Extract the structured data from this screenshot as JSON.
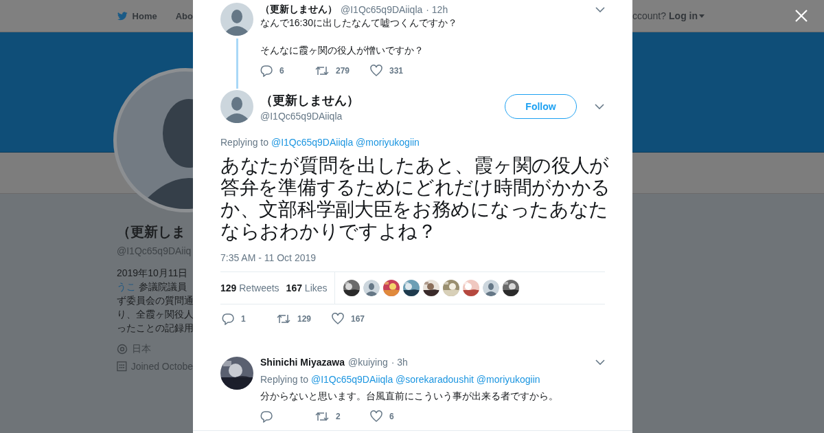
{
  "header": {
    "nav_items": [
      "Home",
      "Abo"
    ],
    "account_prompt": "ccount?",
    "login": "Log in"
  },
  "profile": {
    "name": "（更新しま",
    "handle": "@I1Qc65q9DAiiq",
    "bio_lines": [
      {
        "text": "2019年10月11日"
      },
      {
        "link": "うこ",
        "text": " 参議院議員"
      },
      {
        "text": "ず委員会の質問通"
      },
      {
        "text": "り、全霞ヶ関役人"
      },
      {
        "text": "ったことの記録用"
      }
    ],
    "location": "日本",
    "joined": "Joined Octobe"
  },
  "parent_tweet": {
    "name": "（更新しません）",
    "handle": "@I1Qc65q9DAiiqla",
    "time": "· 12h",
    "paragraphs": [
      "なんで16:30に出したなんて嘘つくんですか？",
      "そんなに霞ヶ関の役人が憎いですか？"
    ],
    "actions": [
      {
        "kind": "reply",
        "count": "6"
      },
      {
        "kind": "retweet",
        "count": "279"
      },
      {
        "kind": "like",
        "count": "331"
      }
    ]
  },
  "main_tweet": {
    "name": "（更新しません）",
    "handle": "@I1Qc65q9DAiiqla",
    "follow": "Follow",
    "replying_label": "Replying to",
    "replying_to": [
      "@I1Qc65q9DAiiqla",
      "@moriyukogiin"
    ],
    "text": "あなたが質問を出したあと、霞ヶ関の役人が答弁を準備するためにどれだけ時間がかかるか、文部科学副大臣をお務めになったあなたならおわかりですよね？",
    "timestamp": "7:35 AM - 11 Oct 2019",
    "stats": [
      {
        "count": "129",
        "label": "Retweets"
      },
      {
        "count": "167",
        "label": "Likes"
      }
    ],
    "liked_by": [
      {
        "kind": "picture"
      },
      {
        "kind": "default"
      },
      {
        "kind": "picture"
      },
      {
        "kind": "picture"
      },
      {
        "kind": "picture"
      },
      {
        "kind": "picture"
      },
      {
        "kind": "picture"
      },
      {
        "kind": "default"
      },
      {
        "kind": "picture"
      }
    ],
    "actions": [
      {
        "kind": "reply",
        "count": "1"
      },
      {
        "kind": "retweet",
        "count": "129"
      },
      {
        "kind": "like",
        "count": "167"
      }
    ]
  },
  "replies": [
    {
      "name": "Shinichi Miyazawa",
      "handle": "@kuiying",
      "time": "· 3h",
      "replying_label": "Replying to",
      "replying_to": [
        "@I1Qc65q9DAiiqla",
        "@sorekaradoushit",
        "@moriyukogiin"
      ],
      "text": "分からないと思います。台風直前にこういう事が出来る者ですから。",
      "actions": [
        {
          "kind": "reply"
        },
        {
          "kind": "retweet",
          "count": "2"
        },
        {
          "kind": "like",
          "count": "6"
        }
      ]
    }
  ]
}
